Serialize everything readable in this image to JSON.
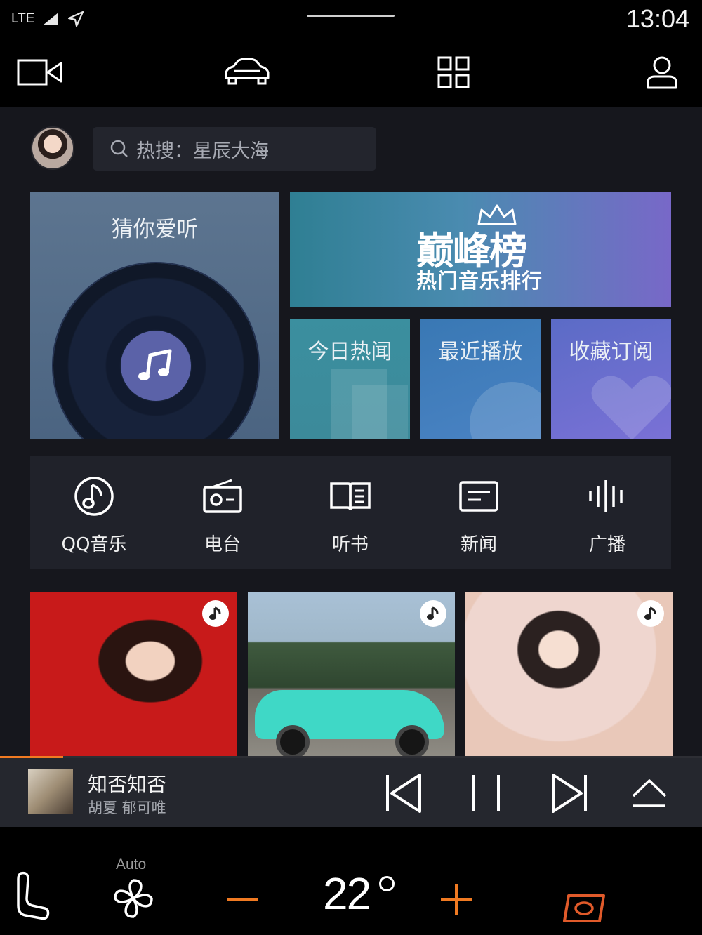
{
  "status": {
    "network": "LTE",
    "time": "13:04"
  },
  "nav": {
    "items": [
      "camera",
      "car",
      "apps",
      "profile"
    ]
  },
  "search": {
    "text": "热搜：星辰大海"
  },
  "cards": {
    "guess": {
      "title": "猜你爱听"
    },
    "peak": {
      "logo": "巅峰榜",
      "subtitle": "热门音乐排行"
    },
    "small": [
      {
        "label": "今日热闻"
      },
      {
        "label": "最近播放"
      },
      {
        "label": "收藏订阅"
      }
    ]
  },
  "categories": [
    {
      "label": "QQ音乐",
      "icon": "qq-music-icon"
    },
    {
      "label": "电台",
      "icon": "radio-icon"
    },
    {
      "label": "听书",
      "icon": "book-icon"
    },
    {
      "label": "新闻",
      "icon": "news-icon"
    },
    {
      "label": "广播",
      "icon": "broadcast-icon"
    }
  ],
  "player": {
    "song": "知否知否",
    "artist": "胡夏  郁可唯",
    "progress": 0.09
  },
  "climate": {
    "mode": "Auto",
    "temperature": "22"
  },
  "colors": {
    "accent": "#f07a22",
    "panel": "#16171d",
    "card": "#20222a"
  }
}
